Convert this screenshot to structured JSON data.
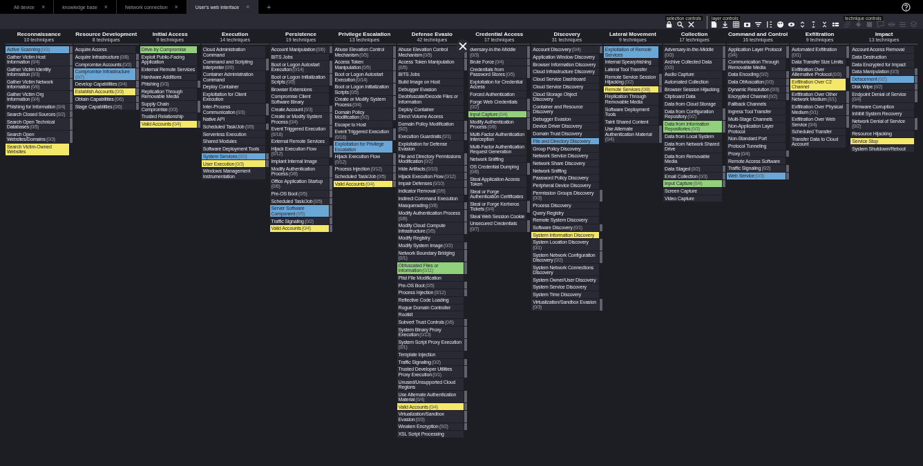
{
  "tabs": [
    {
      "label": "All device",
      "close": "×",
      "selected": false
    },
    {
      "label": "knowledge base",
      "close": "×",
      "selected": false
    },
    {
      "label": "Network connection",
      "close": "×",
      "selected": false
    },
    {
      "label": "User's web interface",
      "close": "×",
      "selected": true
    }
  ],
  "new_tab": "+",
  "toolbar": [
    {
      "label": "selection controls",
      "disabled": false
    },
    {
      "label": "layer controls",
      "disabled": false
    },
    {
      "label": "technique controls",
      "disabled": true
    }
  ],
  "tactics": [
    {
      "name": "Reconnaissance",
      "count": "10 techniques",
      "techniques": [
        {
          "name": "Active Scanning",
          "sub": "(0/3)",
          "color": "#6aa6d6"
        },
        {
          "name": "Gather Victim Host Information",
          "sub": "(0/4)"
        },
        {
          "name": "Gather Victim Identity Information",
          "sub": "(0/3)"
        },
        {
          "name": "Gather Victim Network Information",
          "sub": "(0/6)"
        },
        {
          "name": "Gather Victim Org Information",
          "sub": "(0/4)"
        },
        {
          "name": "Phishing for Information",
          "sub": "(0/4)"
        },
        {
          "name": "Search Closed Sources",
          "sub": "(0/2)"
        },
        {
          "name": "Search Open Technical Databases",
          "sub": "(0/5)"
        },
        {
          "name": "Search Open Websites/Domains",
          "sub": "(0/3)"
        },
        {
          "name": "Search Victim-Owned Websites",
          "color": "#f3e86a"
        }
      ]
    },
    {
      "name": "Resource Development",
      "count": "8 techniques",
      "techniques": [
        {
          "name": "Acquire Access"
        },
        {
          "name": "Acquire Infrastructure",
          "sub": "(0/8)"
        },
        {
          "name": "Compromise Accounts",
          "sub": "(0/3)"
        },
        {
          "name": "Compromise Infrastructure",
          "sub": "(0/7)",
          "color": "#6aa6d6"
        },
        {
          "name": "Develop Capabilities",
          "sub": "(0/4)"
        },
        {
          "name": "Establish Accounts",
          "sub": "(0/3)",
          "color": "#f3e86a"
        },
        {
          "name": "Obtain Capabilities",
          "sub": "(0/6)"
        },
        {
          "name": "Stage Capabilities",
          "sub": "(0/6)"
        }
      ]
    },
    {
      "name": "Initial Access",
      "count": "9 techniques",
      "techniques": [
        {
          "name": "Drive-by Compromise",
          "color": "#92d07e"
        },
        {
          "name": "Exploit Public-Facing Application"
        },
        {
          "name": "External Remote Services"
        },
        {
          "name": "Hardware Additions"
        },
        {
          "name": "Phishing",
          "sub": "(0/3)"
        },
        {
          "name": "Replication Through Removable Media"
        },
        {
          "name": "Supply Chain Compromise",
          "sub": "(0/3)"
        },
        {
          "name": "Trusted Relationship"
        },
        {
          "name": "Valid Accounts",
          "sub": "(0/4)",
          "color": "#f3e86a"
        }
      ]
    },
    {
      "name": "Execution",
      "count": "14 techniques",
      "techniques": [
        {
          "name": "Cloud Administration Command"
        },
        {
          "name": "Command and Scripting Interpreter",
          "sub": "(0/9)"
        },
        {
          "name": "Container Administration Command"
        },
        {
          "name": "Deploy Container"
        },
        {
          "name": "Exploitation for Client Execution"
        },
        {
          "name": "Inter-Process Communication",
          "sub": "(0/3)"
        },
        {
          "name": "Native API"
        },
        {
          "name": "Scheduled Task/Job",
          "sub": "(0/5)"
        },
        {
          "name": "Serverless Execution"
        },
        {
          "name": "Shared Modules"
        },
        {
          "name": "Software Deployment Tools"
        },
        {
          "name": "System Services",
          "sub": "(0/2)",
          "color": "#6aa6d6"
        },
        {
          "name": "User Execution",
          "sub": "(0/3)",
          "color": "#f3e86a"
        },
        {
          "name": "Windows Management Instrumentation"
        }
      ]
    },
    {
      "name": "Persistence",
      "count": "19 techniques",
      "techniques": [
        {
          "name": "Account Manipulation",
          "sub": "(0/6)"
        },
        {
          "name": "BITS Jobs"
        },
        {
          "name": "Boot or Logon Autostart Execution",
          "sub": "(0/14)"
        },
        {
          "name": "Boot or Logon Initialization Scripts",
          "sub": "(0/5)"
        },
        {
          "name": "Browser Extensions"
        },
        {
          "name": "Compromise Client Software Binary"
        },
        {
          "name": "Create Account",
          "sub": "(0/3)"
        },
        {
          "name": "Create or Modify System Process",
          "sub": "(0/4)"
        },
        {
          "name": "Event Triggered Execution",
          "sub": "(0/16)"
        },
        {
          "name": "External Remote Services"
        },
        {
          "name": "Hijack Execution Flow",
          "sub": "(0/12)"
        },
        {
          "name": "Implant Internal Image"
        },
        {
          "name": "Modify Authentication Process",
          "sub": "(0/8)"
        },
        {
          "name": "Office Application Startup",
          "sub": "(0/6)"
        },
        {
          "name": "Pre-OS Boot",
          "sub": "(0/5)"
        },
        {
          "name": "Scheduled Task/Job",
          "sub": "(0/5)"
        },
        {
          "name": "Server Software Component",
          "sub": "(0/5)",
          "color": "#6aa6d6"
        },
        {
          "name": "Traffic Signaling",
          "sub": "(0/2)"
        },
        {
          "name": "Valid Accounts",
          "sub": "(0/4)",
          "color": "#f3e86a"
        }
      ]
    },
    {
      "name": "Privilege Escalation",
      "count": "13 techniques",
      "techniques": [
        {
          "name": "Abuse Elevation Control Mechanism",
          "sub": "(0/5)"
        },
        {
          "name": "Access Token Manipulation",
          "sub": "(0/5)"
        },
        {
          "name": "Boot or Logon Autostart Execution",
          "sub": "(0/14)"
        },
        {
          "name": "Boot or Logon Initialization Scripts",
          "sub": "(0/5)"
        },
        {
          "name": "Create or Modify System Process",
          "sub": "(0/4)"
        },
        {
          "name": "Domain Policy Modification",
          "sub": "(0/2)"
        },
        {
          "name": "Escape to Host"
        },
        {
          "name": "Event Triggered Execution",
          "sub": "(0/16)"
        },
        {
          "name": "Exploitation for Privilege Escalation",
          "color": "#6aa6d6"
        },
        {
          "name": "Hijack Execution Flow",
          "sub": "(0/12)"
        },
        {
          "name": "Process Injection",
          "sub": "(0/12)"
        },
        {
          "name": "Scheduled Task/Job",
          "sub": "(0/5)"
        },
        {
          "name": "Valid Accounts",
          "sub": "(0/4)",
          "color": "#f3e86a"
        }
      ]
    },
    {
      "name": "Defense Evasio",
      "count": "42 techniques",
      "techniques": [
        {
          "name": "Abuse Elevation Control Mechanism",
          "sub": "(0/5)"
        },
        {
          "name": "Access Token Manipulation",
          "sub": "(0/5)"
        },
        {
          "name": "BITS Jobs"
        },
        {
          "name": "Build Image on Host"
        },
        {
          "name": "Debugger Evasion"
        },
        {
          "name": "Deobfuscate/Decode Files or Information"
        },
        {
          "name": "Deploy Container"
        },
        {
          "name": "Direct Volume Access"
        },
        {
          "name": "Domain Policy Modification",
          "sub": "(0/2)"
        },
        {
          "name": "Execution Guardrails",
          "sub": "(0/1)"
        },
        {
          "name": "Exploitation for Defense Evasion"
        },
        {
          "name": "File and Directory Permissions Modification",
          "sub": "(0/2)"
        },
        {
          "name": "Hide Artifacts",
          "sub": "(0/10)"
        },
        {
          "name": "Hijack Execution Flow",
          "sub": "(0/12)"
        },
        {
          "name": "Impair Defenses",
          "sub": "(0/10)"
        },
        {
          "name": "Indicator Removal",
          "sub": "(0/9)"
        },
        {
          "name": "Indirect Command Execution"
        },
        {
          "name": "Masquerading",
          "sub": "(0/8)"
        },
        {
          "name": "Modify Authentication Process",
          "sub": "(0/8)"
        },
        {
          "name": "Modify Cloud Compute Infrastructure",
          "sub": "(0/5)"
        },
        {
          "name": "Modify Registry"
        },
        {
          "name": "Modify System Image",
          "sub": "(0/2)"
        },
        {
          "name": "Network Boundary Bridging",
          "sub": "(0/1)"
        },
        {
          "name": "Obfuscated Files or Information",
          "sub": "(0/11)",
          "color": "#92d07e"
        },
        {
          "name": "Plist File Modification"
        },
        {
          "name": "Pre-OS Boot",
          "sub": "(0/5)"
        },
        {
          "name": "Process Injection",
          "sub": "(0/12)"
        },
        {
          "name": "Reflective Code Loading"
        },
        {
          "name": "Rogue Domain Controller"
        },
        {
          "name": "Rootkit"
        },
        {
          "name": "Subvert Trust Controls",
          "sub": "(0/6)"
        },
        {
          "name": "System Binary Proxy Execution",
          "sub": "(0/13)"
        },
        {
          "name": "System Script Proxy Execution",
          "sub": "(0/1)"
        },
        {
          "name": "Template Injection"
        },
        {
          "name": "Traffic Signaling",
          "sub": "(0/2)"
        },
        {
          "name": "Trusted Developer Utilities Proxy Execution",
          "sub": "(0/1)"
        },
        {
          "name": "Unused/Unsupported Cloud Regions"
        },
        {
          "name": "Use Alternate Authentication Material",
          "sub": "(0/4)"
        },
        {
          "name": "Valid Accounts",
          "sub": "(0/4)",
          "color": "#f3e86a"
        },
        {
          "name": "Virtualization/Sandbox Evasion",
          "sub": "(0/3)"
        },
        {
          "name": "Weaken Encryption",
          "sub": "(0/2)"
        },
        {
          "name": "XSL Script Processing"
        }
      ]
    },
    {
      "name": "Credential Access",
      "count": "17 techniques",
      "techniques": [
        {
          "name": "dversary-in-the-Middle",
          "sub": "(0/3)"
        },
        {
          "name": "Brute Force",
          "sub": "(0/4)"
        },
        {
          "name": "Credentials from Password Stores",
          "sub": "(0/5)"
        },
        {
          "name": "Exploitation for Credential Access"
        },
        {
          "name": "Forced Authentication"
        },
        {
          "name": "Forge Web Credentials",
          "sub": "(0/2)"
        },
        {
          "name": "Input Capture",
          "sub": "(0/4)",
          "color": "#92d07e"
        },
        {
          "name": "Modify Authentication Process",
          "sub": "(0/8)"
        },
        {
          "name": "Multi-Factor Authentication Interception"
        },
        {
          "name": "Multi-Factor Authentication Request Generation"
        },
        {
          "name": "Network Sniffing"
        },
        {
          "name": "OS Credential Dumping",
          "sub": "(0/8)"
        },
        {
          "name": "Steal Application Access Token"
        },
        {
          "name": "Steal or Forge Authentication Certificates"
        },
        {
          "name": "Steal or Forge Kerberos Tickets",
          "sub": "(0/4)"
        },
        {
          "name": "Steal Web Session Cookie"
        },
        {
          "name": "Unsecured Credentials",
          "sub": "(0/7)"
        }
      ]
    },
    {
      "name": "Discovery",
      "count": "31 techniques",
      "techniques": [
        {
          "name": "Account Discovery",
          "sub": "(0/4)"
        },
        {
          "name": "Application Window Discovery"
        },
        {
          "name": "Browser Information Discovery"
        },
        {
          "name": "Cloud Infrastructure Discovery"
        },
        {
          "name": "Cloud Service Dashboard"
        },
        {
          "name": "Cloud Service Discovery"
        },
        {
          "name": "Cloud Storage Object Discovery"
        },
        {
          "name": "Container and Resource Discovery"
        },
        {
          "name": "Debugger Evasion"
        },
        {
          "name": "Device Driver Discovery"
        },
        {
          "name": "Domain Trust Discovery"
        },
        {
          "name": "File and Directory Discovery",
          "color": "#6aa6d6"
        },
        {
          "name": "Group Policy Discovery"
        },
        {
          "name": "Network Service Discovery"
        },
        {
          "name": "Network Share Discovery"
        },
        {
          "name": "Network Sniffing"
        },
        {
          "name": "Password Policy Discovery"
        },
        {
          "name": "Peripheral Device Discovery"
        },
        {
          "name": "Permission Groups Discovery",
          "sub": "(0/3)"
        },
        {
          "name": "Process Discovery"
        },
        {
          "name": "Query Registry"
        },
        {
          "name": "Remote System Discovery"
        },
        {
          "name": "Software Discovery",
          "sub": "(0/1)"
        },
        {
          "name": "System Information Discovery",
          "color": "#f3e86a"
        },
        {
          "name": "System Location Discovery",
          "sub": "(0/1)"
        },
        {
          "name": "System Network Configuration Discovery",
          "sub": "(0/2)"
        },
        {
          "name": "System Network Connections Discovery"
        },
        {
          "name": "System Owner/User Discovery"
        },
        {
          "name": "System Service Discovery"
        },
        {
          "name": "System Time Discovery"
        },
        {
          "name": "Virtualization/Sandbox Evasion",
          "sub": "(0/3)"
        }
      ]
    },
    {
      "name": "Lateral Movement",
      "count": "9 techniques",
      "techniques": [
        {
          "name": "Exploitation of Remote Services",
          "color": "#6aa6d6"
        },
        {
          "name": "Internal Spearphishing"
        },
        {
          "name": "Lateral Tool Transfer"
        },
        {
          "name": "Remote Service Session Hijacking",
          "sub": "(0/2)"
        },
        {
          "name": "Remote Services",
          "sub": "(0/8)",
          "color": "#f3e86a"
        },
        {
          "name": "Replication Through Removable Media"
        },
        {
          "name": "Software Deployment Tools"
        },
        {
          "name": "Taint Shared Content"
        },
        {
          "name": "Use Alternate Authentication Material",
          "sub": "(0/4)"
        }
      ]
    },
    {
      "name": "Collection",
      "count": "17 techniques",
      "techniques": [
        {
          "name": "Adversary-in-the-Middle",
          "sub": "(0/3)"
        },
        {
          "name": "Archive Collected Data",
          "sub": "(0/3)"
        },
        {
          "name": "Audio Capture"
        },
        {
          "name": "Automated Collection"
        },
        {
          "name": "Browser Session Hijacking"
        },
        {
          "name": "Clipboard Data"
        },
        {
          "name": "Data from Cloud Storage"
        },
        {
          "name": "Data from Configuration Repository",
          "sub": "(0/2)"
        },
        {
          "name": "Data from Information Repositories",
          "sub": "(0/3)",
          "color": "#92d07e"
        },
        {
          "name": "Data from Local System"
        },
        {
          "name": "Data from Network Shared Drive"
        },
        {
          "name": "Data from Removable Media"
        },
        {
          "name": "Data Staged",
          "sub": "(0/2)"
        },
        {
          "name": "Email Collection",
          "sub": "(0/3)"
        },
        {
          "name": "Input Capture",
          "sub": "(0/4)",
          "color": "#92d07e"
        },
        {
          "name": "Screen Capture"
        },
        {
          "name": "Video Capture"
        }
      ]
    },
    {
      "name": "Command and Control",
      "count": "16 techniques",
      "techniques": [
        {
          "name": "Application Layer Protocol",
          "sub": "(0/4)"
        },
        {
          "name": "Communication Through Removable Media"
        },
        {
          "name": "Data Encoding",
          "sub": "(0/2)"
        },
        {
          "name": "Data Obfuscation",
          "sub": "(0/3)"
        },
        {
          "name": "Dynamic Resolution",
          "sub": "(0/3)"
        },
        {
          "name": "Encrypted Channel",
          "sub": "(0/2)"
        },
        {
          "name": "Fallback Channels"
        },
        {
          "name": "Ingress Tool Transfer"
        },
        {
          "name": "Multi-Stage Channels"
        },
        {
          "name": "Non-Application Layer Protocol"
        },
        {
          "name": "Non-Standard Port"
        },
        {
          "name": "Protocol Tunneling"
        },
        {
          "name": "Proxy",
          "sub": "(0/4)"
        },
        {
          "name": "Remote Access Software"
        },
        {
          "name": "Traffic Signaling",
          "sub": "(0/2)"
        },
        {
          "name": "Web Service",
          "sub": "(0/3)",
          "color": "#6aa6d6"
        }
      ]
    },
    {
      "name": "Exfiltration",
      "count": "9 techniques",
      "techniques": [
        {
          "name": "Automated Exfiltration",
          "sub": "(0/1)"
        },
        {
          "name": "Data Transfer Size Limits"
        },
        {
          "name": "Exfiltration Over Alternative Protocol",
          "sub": "(0/3)"
        },
        {
          "name": "Exfiltration Over C2 Channel",
          "color": "#f3e86a"
        },
        {
          "name": "Exfiltration Over Other Network Medium",
          "sub": "(0/1)"
        },
        {
          "name": "Exfiltration Over Physical Medium",
          "sub": "(0/1)"
        },
        {
          "name": "Exfiltration Over Web Service",
          "sub": "(0/4)"
        },
        {
          "name": "Scheduled Transfer"
        },
        {
          "name": "Transfer Data to Cloud Account"
        }
      ]
    },
    {
      "name": "Impact",
      "count": "13 techniques",
      "techniques": [
        {
          "name": "Account Access Removal"
        },
        {
          "name": "Data Destruction"
        },
        {
          "name": "Data Encrypted for Impact"
        },
        {
          "name": "Data Manipulation",
          "sub": "(0/3)"
        },
        {
          "name": "Defacement",
          "sub": "(0/2)",
          "color": "#6aa6d6"
        },
        {
          "name": "Disk Wipe",
          "sub": "(0/2)"
        },
        {
          "name": "Endpoint Denial of Service",
          "sub": "(0/4)"
        },
        {
          "name": "Firmware Corruption"
        },
        {
          "name": "Inhibit System Recovery"
        },
        {
          "name": "Network Denial of Service",
          "sub": "(0/2)"
        },
        {
          "name": "Resource Hijacking"
        },
        {
          "name": "Service Stop",
          "color": "#f3e86a"
        },
        {
          "name": "System Shutdown/Reboot"
        }
      ]
    }
  ]
}
